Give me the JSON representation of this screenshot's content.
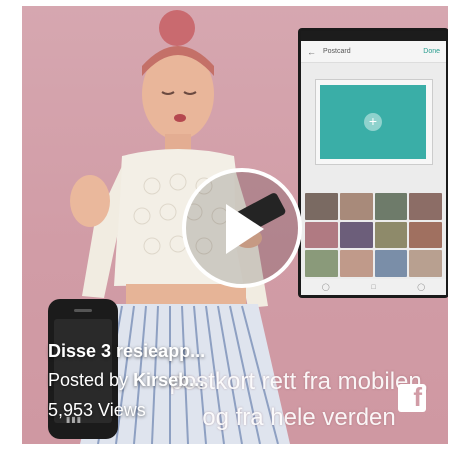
{
  "video": {
    "title": "Disse 3 resieapp...",
    "posted_by_prefix": "Posted by ",
    "author": "Kirseb...",
    "views": "5,953 Views",
    "subtitle_line1": "postkort rett fra mobilen,",
    "subtitle_line2": "og fra hele verden"
  },
  "phone_screenshot": {
    "app_title": "Postcard",
    "done_label": "Done",
    "plus": "+",
    "back": "←"
  },
  "icons": {
    "play": "play-icon",
    "facebook": "facebook-icon",
    "phone": "phone-icon"
  },
  "facebook_glyph": "f",
  "colors": {
    "background": "#d6a7b0",
    "teal": "#3aaea7",
    "white": "#ffffff"
  }
}
